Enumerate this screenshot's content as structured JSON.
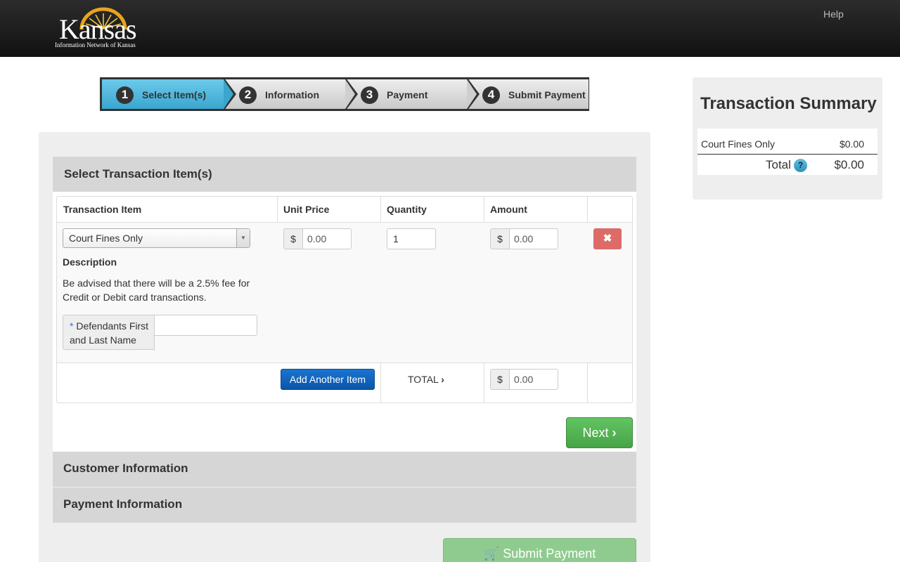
{
  "header": {
    "logo_text": "Kansas",
    "logo_subtext": "Information Network of Kansas",
    "help_label": "Help"
  },
  "steps": [
    {
      "number": "1",
      "label": "Select Item(s)",
      "active": true
    },
    {
      "number": "2",
      "label": "Information",
      "active": false
    },
    {
      "number": "3",
      "label": "Payment",
      "active": false
    },
    {
      "number": "4",
      "label": "Submit Payment",
      "active": false
    }
  ],
  "select_section": {
    "title": "Select Transaction Item(s)",
    "columns": [
      "Transaction Item",
      "Unit Price",
      "Quantity",
      "Amount"
    ],
    "item": {
      "selected": "Court Fines Only",
      "description_title": "Description",
      "description_text": "Be advised that there will be a 2.5% fee for Credit or Debit card transactions.",
      "name_required_marker": "*",
      "name_label": "Defendants First and Last Name",
      "name_value": "",
      "currency_symbol": "$",
      "unit_price": "0.00",
      "quantity": "1",
      "amount": "0.00",
      "delete_icon": "✖"
    },
    "add_button": "Add Another Item",
    "total_label": "TOTAL",
    "total_currency": "$",
    "total_value": "0.00",
    "next_button": "Next"
  },
  "customer_section": {
    "title": "Customer Information"
  },
  "payment_section": {
    "title": "Payment Information"
  },
  "submit_button": "Submit Payment",
  "summary": {
    "title": "Transaction Summary",
    "item_name": "Court Fines Only",
    "item_value": "$0.00",
    "total_label": "Total",
    "help_icon": "?",
    "total_value": "$0.00"
  },
  "colors": {
    "active_step": "#3aa6cf",
    "next_button": "#47a447",
    "add_button": "#0b55a8",
    "delete_button": "#d9534f"
  }
}
